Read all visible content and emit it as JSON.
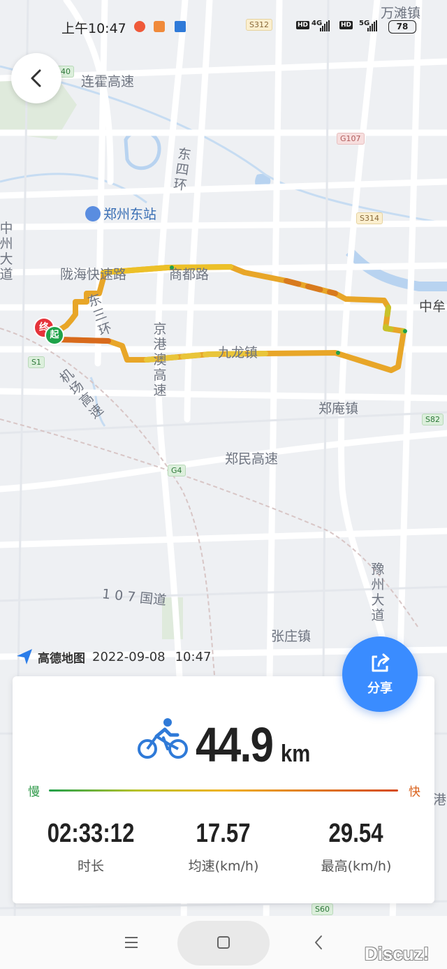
{
  "status_bar": {
    "time": "上午10:47",
    "network_1": "4G",
    "network_2": "5G",
    "hd": "HD",
    "battery": "78"
  },
  "map": {
    "labels": {
      "wantan": "万滩镇",
      "lianhuo": "连霍高速",
      "dongsihuan": "东四环",
      "zhengzhou_east": "郑州东站",
      "longhai": "陇海快速路",
      "shangdu": "商都路",
      "dongsanhuan": "东三环",
      "zhongmou": "中牟",
      "jiulong": "九龙镇",
      "jinggangao": "京港澳高速",
      "jichang": "机场高速",
      "zhengan": "郑庵镇",
      "zhengmin": "郑民高速",
      "guodao107": "1 0 7 国道",
      "zhangzhuang": "张庄镇",
      "yuzhou": "豫州大道",
      "zhongzhou": "中州大道",
      "gang": "港"
    },
    "shields": {
      "s312": "S312",
      "g107": "G107",
      "s314": "S314",
      "s82": "S82",
      "g4": "G4",
      "s1": "S1",
      "s60": "S60",
      "top_left": "40"
    },
    "markers": {
      "end": "终",
      "start": "起"
    }
  },
  "footer": {
    "brand": "高德地图",
    "date": "2022-09-08",
    "time": "10:47"
  },
  "share_button": {
    "label": "分享"
  },
  "summary": {
    "activity_icon": "bicycle-icon",
    "distance": "44.9",
    "distance_unit": "km",
    "legend_slow": "慢",
    "legend_fast": "快",
    "duration": "02:33:12",
    "duration_label": "时长",
    "avg_speed": "17.57",
    "avg_speed_label": "均速(km/h)",
    "max_speed": "29.54",
    "max_speed_label": "最高(km/h)"
  },
  "colors": {
    "accent_blue": "#3A8CFF",
    "route_yellow": "#F0B21E",
    "route_orange": "#E07A1C",
    "route_green": "#21A04A",
    "end_marker": "#E5333B",
    "start_marker": "#1FA34A"
  },
  "watermark": "Discuz!"
}
